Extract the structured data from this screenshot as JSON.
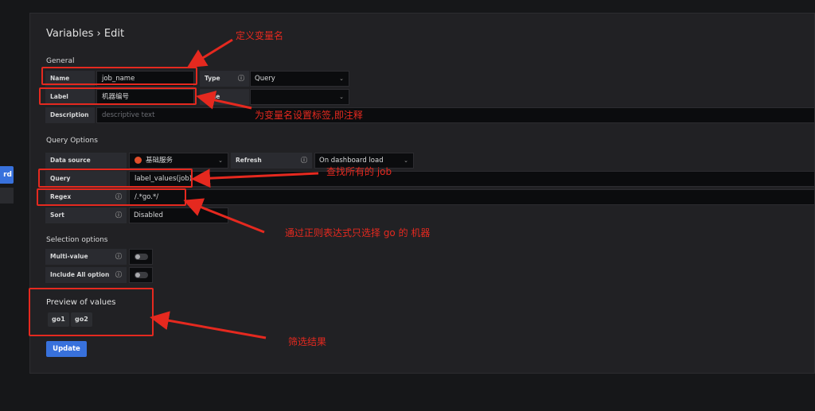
{
  "left_rail": {
    "active_item": "rd"
  },
  "header": {
    "title": "Variables › Edit"
  },
  "general": {
    "section_title": "General",
    "name_label": "Name",
    "name_value": "job_name",
    "type_label": "Type",
    "type_value": "Query",
    "label_label": "Label",
    "label_value": "机器编号",
    "hide_label": "Hide",
    "hide_value": "",
    "description_label": "Description",
    "description_placeholder": "descriptive text"
  },
  "query_options": {
    "section_title": "Query Options",
    "datasource_label": "Data source",
    "datasource_value": "基础服务",
    "refresh_label": "Refresh",
    "refresh_value": "On dashboard load",
    "query_label": "Query",
    "query_value": "label_values(job)",
    "regex_label": "Regex",
    "regex_value": "/.*go.*/",
    "sort_label": "Sort",
    "sort_value": "Disabled"
  },
  "selection_options": {
    "section_title": "Selection options",
    "multi_value_label": "Multi-value",
    "include_all_label": "Include All option"
  },
  "preview": {
    "title": "Preview of values",
    "values": [
      "go1",
      "go2"
    ]
  },
  "actions": {
    "update_label": "Update"
  },
  "annotations": {
    "name": "定义变量名",
    "label": "为变量名设置标签,即注释",
    "query": "查找所有的 job",
    "regex": "通过正则表达式只选择 go 的 机器",
    "preview": "筛选结果"
  },
  "colors": {
    "accent": "#3871dc",
    "annotation": "#e5291f",
    "datasource_icon": "#e04e2a"
  }
}
